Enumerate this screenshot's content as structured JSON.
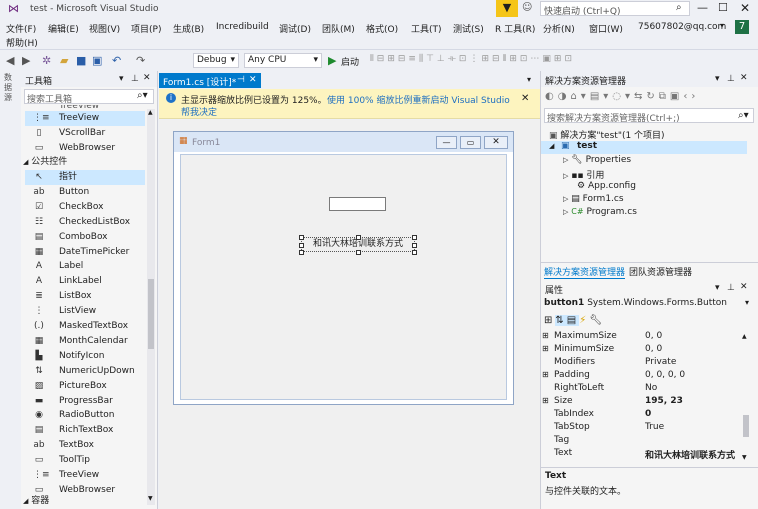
{
  "title": {
    "text": "test - Microsoft Visual Studio",
    "quick_launch": "快速启动 (Ctrl+Q)"
  },
  "menu": {
    "items": [
      "文件(F)",
      "编辑(E)",
      "视图(V)",
      "项目(P)",
      "生成(B)",
      "Incredibuild",
      "调试(D)",
      "团队(M)",
      "格式(O)",
      "工具(T)",
      "测试(S)",
      "R 工具(R)",
      "分析(N)",
      "窗口(W)"
    ],
    "help": "帮助(H)",
    "account": "75607802@qq.com",
    "badge": "7"
  },
  "toolbar": {
    "config": "Debug",
    "platform": "Any CPU",
    "start": "启动"
  },
  "side_strip": {
    "label": "数据源"
  },
  "toolbox": {
    "title": "工具箱",
    "search_placeholder": "搜索工具箱",
    "partial": "TreeView",
    "top_items": [
      {
        "icon": "⋮≡",
        "label": "TreeView"
      },
      {
        "icon": "▯",
        "label": "VScrollBar"
      },
      {
        "icon": "▭",
        "label": "WebBrowser"
      }
    ],
    "group_common": "公共控件",
    "common": [
      {
        "icon": "↖",
        "label": "指针"
      },
      {
        "icon": "ab",
        "label": "Button"
      },
      {
        "icon": "☑",
        "label": "CheckBox"
      },
      {
        "icon": "☷",
        "label": "CheckedListBox"
      },
      {
        "icon": "▤",
        "label": "ComboBox"
      },
      {
        "icon": "▦",
        "label": "DateTimePicker"
      },
      {
        "icon": "A",
        "label": "Label"
      },
      {
        "icon": "A",
        "label": "LinkLabel"
      },
      {
        "icon": "≣",
        "label": "ListBox"
      },
      {
        "icon": "⋮",
        "label": "ListView"
      },
      {
        "icon": "(.)",
        "label": "MaskedTextBox"
      },
      {
        "icon": "▦",
        "label": "MonthCalendar"
      },
      {
        "icon": "▙",
        "label": "NotifyIcon"
      },
      {
        "icon": "⇅",
        "label": "NumericUpDown"
      },
      {
        "icon": "▨",
        "label": "PictureBox"
      },
      {
        "icon": "▬",
        "label": "ProgressBar"
      },
      {
        "icon": "◉",
        "label": "RadioButton"
      },
      {
        "icon": "▤",
        "label": "RichTextBox"
      },
      {
        "icon": "ab",
        "label": "TextBox"
      },
      {
        "icon": "▭",
        "label": "ToolTip"
      },
      {
        "icon": "⋮≡",
        "label": "TreeView"
      },
      {
        "icon": "▭",
        "label": "WebBrowser"
      }
    ],
    "group_containers": "容器"
  },
  "document": {
    "tab_label": "Form1.cs [设计]*",
    "info_text": "主显示器缩放比例已设置为 125%。",
    "info_link": "使用 100% 缩放比例重新启动 Visual Studio",
    "info_help": "帮我决定",
    "form_title": "Form1",
    "button_text": "和讯大林培训联系方式"
  },
  "solution": {
    "title": "解决方案资源管理器",
    "search_placeholder": "搜索解决方案资源管理器(Ctrl+;)",
    "root": "解决方案\"test\"(1 个项目)",
    "project": "test",
    "nodes": [
      "Properties",
      "引用",
      "App.config",
      "Form1.cs",
      "Program.cs"
    ],
    "tabs": [
      "解决方案资源管理器",
      "团队资源管理器"
    ]
  },
  "properties": {
    "title": "属性",
    "object_name": "button1",
    "object_type": "System.Windows.Forms.Button",
    "rows": [
      {
        "expand": "⊞",
        "name": "MaximumSize",
        "value": "0, 0",
        "bold": false
      },
      {
        "expand": "⊞",
        "name": "MinimumSize",
        "value": "0, 0",
        "bold": false
      },
      {
        "expand": "",
        "name": "Modifiers",
        "value": "Private",
        "bold": false
      },
      {
        "expand": "⊞",
        "name": "Padding",
        "value": "0, 0, 0, 0",
        "bold": false
      },
      {
        "expand": "",
        "name": "RightToLeft",
        "value": "No",
        "bold": false
      },
      {
        "expand": "⊞",
        "name": "Size",
        "value": "195, 23",
        "bold": true
      },
      {
        "expand": "",
        "name": "TabIndex",
        "value": "0",
        "bold": true
      },
      {
        "expand": "",
        "name": "TabStop",
        "value": "True",
        "bold": false
      },
      {
        "expand": "",
        "name": "Tag",
        "value": "",
        "bold": false
      },
      {
        "expand": "",
        "name": "Text",
        "value": "和讯大林培训联系方式",
        "bold": true
      }
    ],
    "desc_title": "Text",
    "desc_text": "与控件关联的文本。"
  },
  "colors": {
    "accent": "#007acc",
    "info_bg": "#fdf4bf",
    "selection": "#cce8ff",
    "badge": "#1e7145"
  }
}
